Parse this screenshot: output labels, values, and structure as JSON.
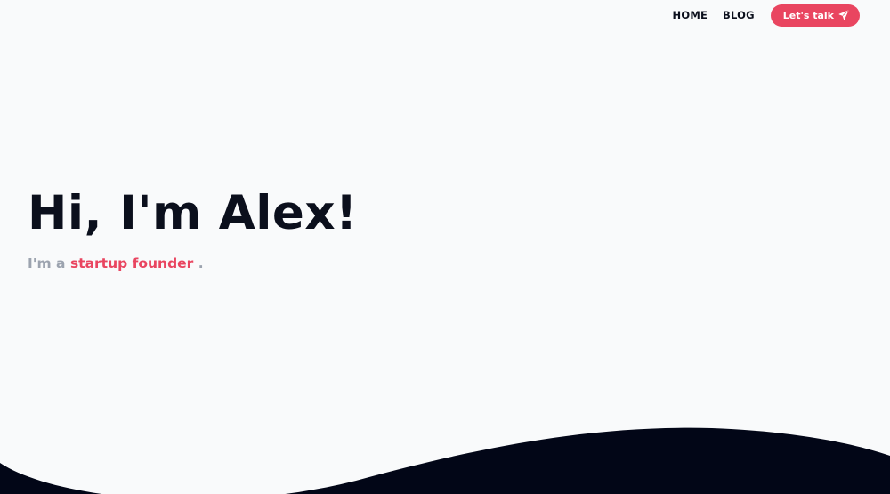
{
  "nav": {
    "home_label": "HOME",
    "blog_label": "BLOG",
    "cta_label": "Let's talk",
    "cta_icon": "paper-plane-icon"
  },
  "hero": {
    "title": "Hi, I'm Alex!",
    "tagline_prefix": "I'm a",
    "tagline_role": "startup founder",
    "tagline_suffix": "."
  },
  "colors": {
    "background": "#f9fafb",
    "text_dark": "#0b0f1c",
    "accent": "#e94560",
    "muted": "#9ca3af",
    "wave": "#020617"
  }
}
